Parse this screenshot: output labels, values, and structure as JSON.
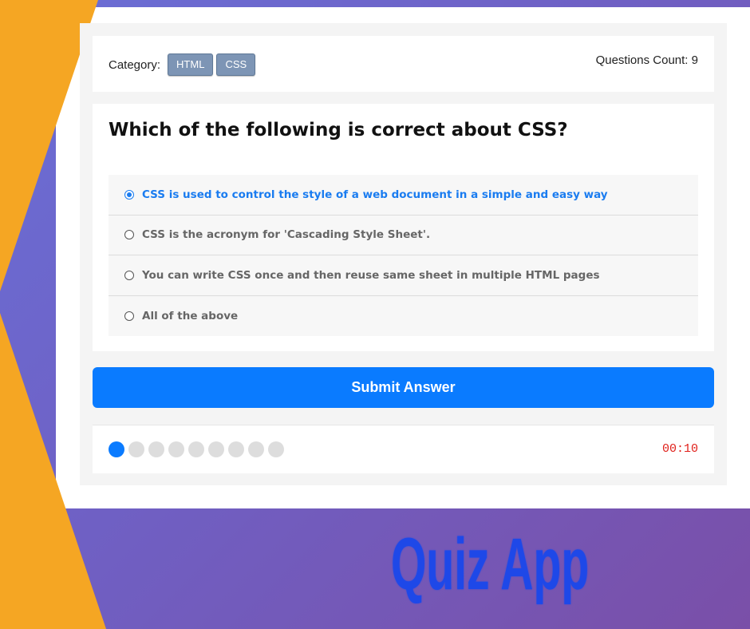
{
  "colors": {
    "background_start": "#6a6fd6",
    "background_end": "#7a4fa8",
    "orange_accent": "#f5a623",
    "primary_blue": "#0a7bff",
    "timer_red": "#e0201a",
    "badge_gray_blue": "#7d95b5",
    "banner_blue": "#1e48e8"
  },
  "quiz_info": {
    "category_label": "Category:",
    "categories": [
      "HTML",
      "CSS"
    ],
    "questions_count_text": "Questions Count: 9"
  },
  "question": {
    "title": "Which of the following is correct about CSS?",
    "answers": [
      {
        "text": "CSS is used to control the style of a web document in a simple and easy way",
        "selected": true
      },
      {
        "text": "CSS is the acronym for 'Cascading Style Sheet'.",
        "selected": false
      },
      {
        "text": "You can write CSS once and then reuse same sheet in multiple HTML pages",
        "selected": false
      },
      {
        "text": "All of the above",
        "selected": false
      }
    ]
  },
  "submit_label": "Submit Answer",
  "progress": {
    "total_bullets": 9,
    "current": 1
  },
  "countdown": "00:10",
  "banner_title": "Quiz App",
  "icons": {
    "radio_checked": "radio-checked-icon",
    "radio_unchecked": "radio-unchecked-icon",
    "progress_dot": "progress-dot-icon"
  }
}
